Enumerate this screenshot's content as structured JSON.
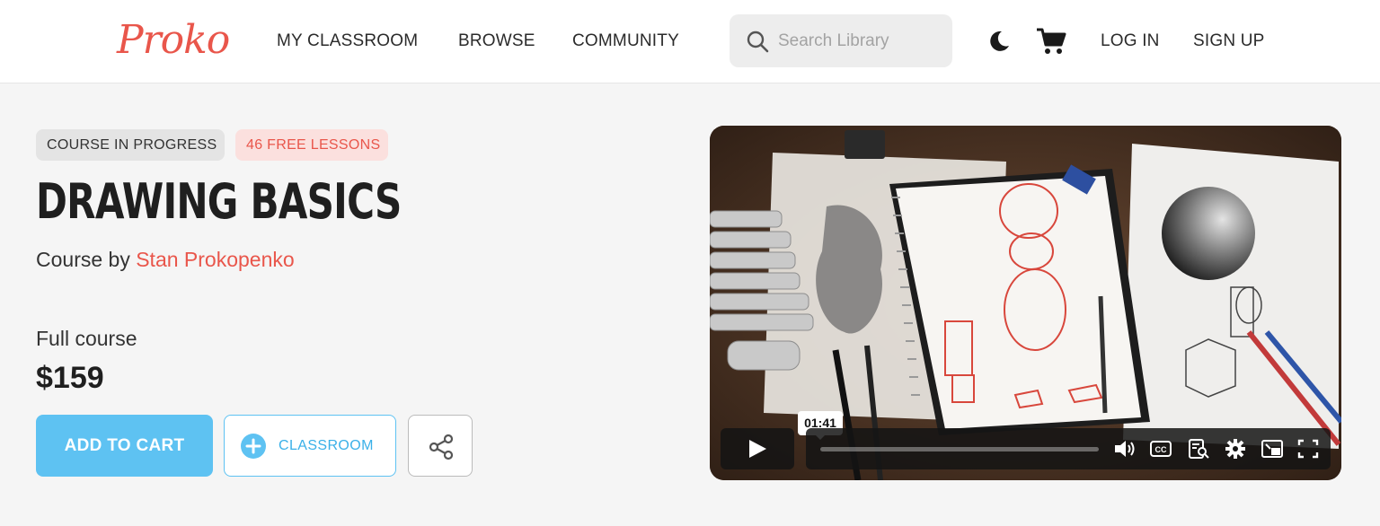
{
  "header": {
    "logo_text": "Proko",
    "nav": [
      "MY CLASSROOM",
      "BROWSE",
      "COMMUNITY"
    ],
    "search_placeholder": "Search Library",
    "login_label": "LOG IN",
    "signup_label": "SIGN UP",
    "icons": [
      "search-icon",
      "dark-mode-moon-icon",
      "cart-icon"
    ]
  },
  "course": {
    "status_badge": "COURSE IN PROGRESS",
    "free_badge": "46 FREE LESSONS",
    "title": "DRAWING BASICS",
    "byline_prefix": "Course by",
    "author": "Stan Prokopenko",
    "price_label": "Full course",
    "price": "$159"
  },
  "actions": {
    "add_to_cart": "ADD TO CART",
    "classroom": "CLASSROOM",
    "icons": [
      "plus-circle-icon",
      "share-icon"
    ]
  },
  "video": {
    "hover_time": "01:41",
    "progress_fraction": 0.0,
    "controls": [
      "play-icon",
      "volume-icon",
      "captions-icon",
      "transcript-search-icon",
      "settings-gear-icon",
      "picture-in-picture-icon",
      "fullscreen-icon"
    ],
    "captions_label": "CC"
  },
  "colors": {
    "brand": "#e9564b",
    "accent": "#5ec2f2",
    "badge_free_bg": "#fbe0de"
  }
}
